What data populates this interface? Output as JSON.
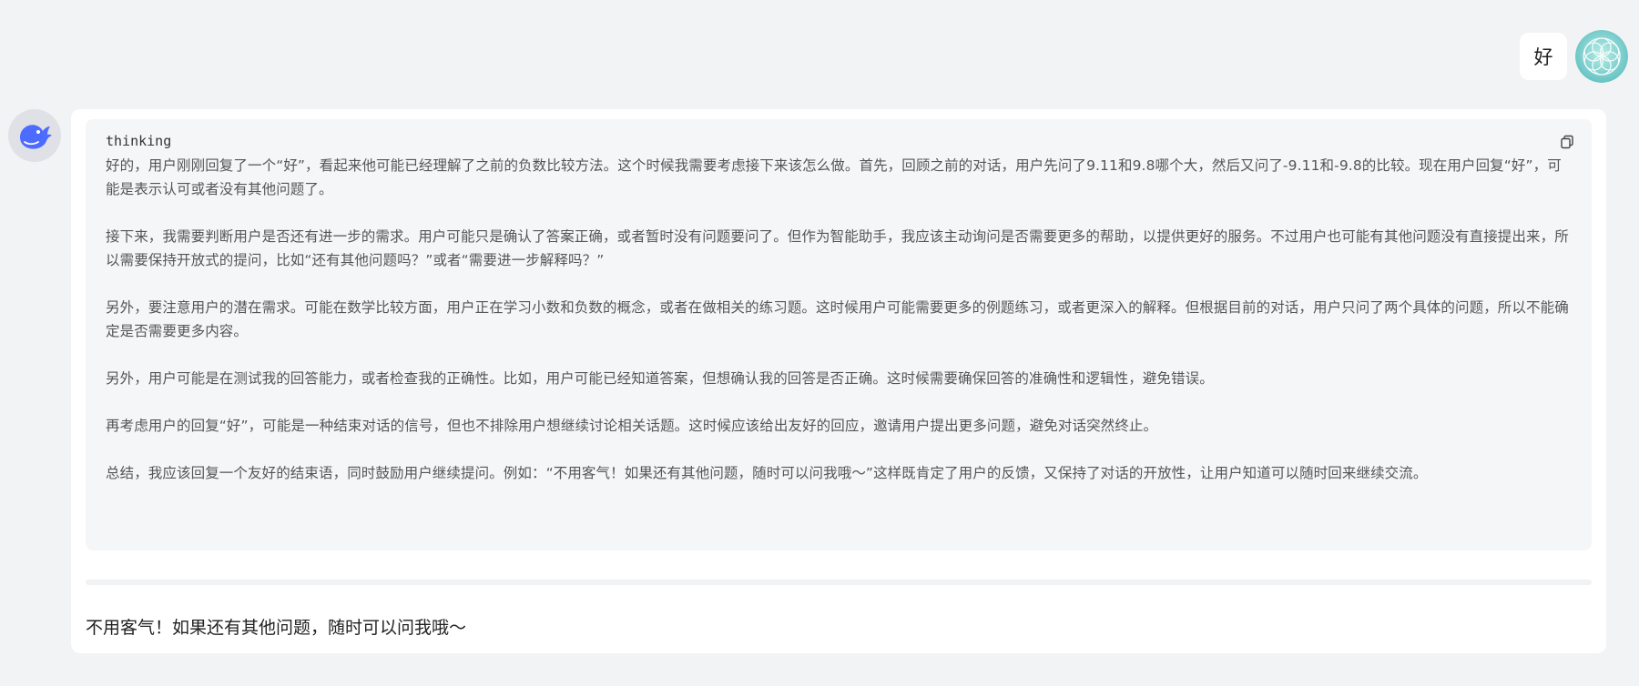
{
  "user_message": {
    "text": "好"
  },
  "assistant": {
    "thinking_label": "thinking",
    "thinking_paragraphs": [
      "好的，用户刚刚回复了一个“好”，看起来他可能已经理解了之前的负数比较方法。这个时候我需要考虑接下来该怎么做。首先，回顾之前的对话，用户先问了9.11和9.8哪个大，然后又问了-9.11和-9.8的比较。现在用户回复“好”，可能是表示认可或者没有其他问题了。",
      "接下来，我需要判断用户是否还有进一步的需求。用户可能只是确认了答案正确，或者暂时没有问题要问了。但作为智能助手，我应该主动询问是否需要更多的帮助，以提供更好的服务。不过用户也可能有其他问题没有直接提出来，所以需要保持开放式的提问，比如“还有其他问题吗？”或者“需要进一步解释吗？”",
      "另外，要注意用户的潜在需求。可能在数学比较方面，用户正在学习小数和负数的概念，或者在做相关的练习题。这时候用户可能需要更多的例题练习，或者更深入的解释。但根据目前的对话，用户只问了两个具体的问题，所以不能确定是否需要更多内容。",
      "另外，用户可能是在测试我的回答能力，或者检查我的正确性。比如，用户可能已经知道答案，但想确认我的回答是否正确。这时候需要确保回答的准确性和逻辑性，避免错误。",
      "再考虑用户的回复“好”，可能是一种结束对话的信号，但也不排除用户想继续讨论相关话题。这时候应该给出友好的回应，邀请用户提出更多问题，避免对话突然终止。",
      "总结，我应该回复一个友好的结束语，同时鼓励用户继续提问。例如：“不用客气！如果还有其他问题，随时可以问我哦～”这样既肯定了用户的反馈，又保持了对话的开放性，让用户知道可以随时回来继续交流。"
    ],
    "final_answer": "不用客气！如果还有其他问题，随时可以问我哦～"
  },
  "icons": {
    "copy": "copy-icon",
    "bot_avatar": "whale-logo-icon",
    "user_avatar": "flower-of-life-icon"
  },
  "colors": {
    "background": "#f2f3f5",
    "card": "#ffffff",
    "thinking_bg": "#f5f6f8",
    "brand_blue": "#4d6bfe",
    "avatar_teal": "#7ccfc9"
  }
}
